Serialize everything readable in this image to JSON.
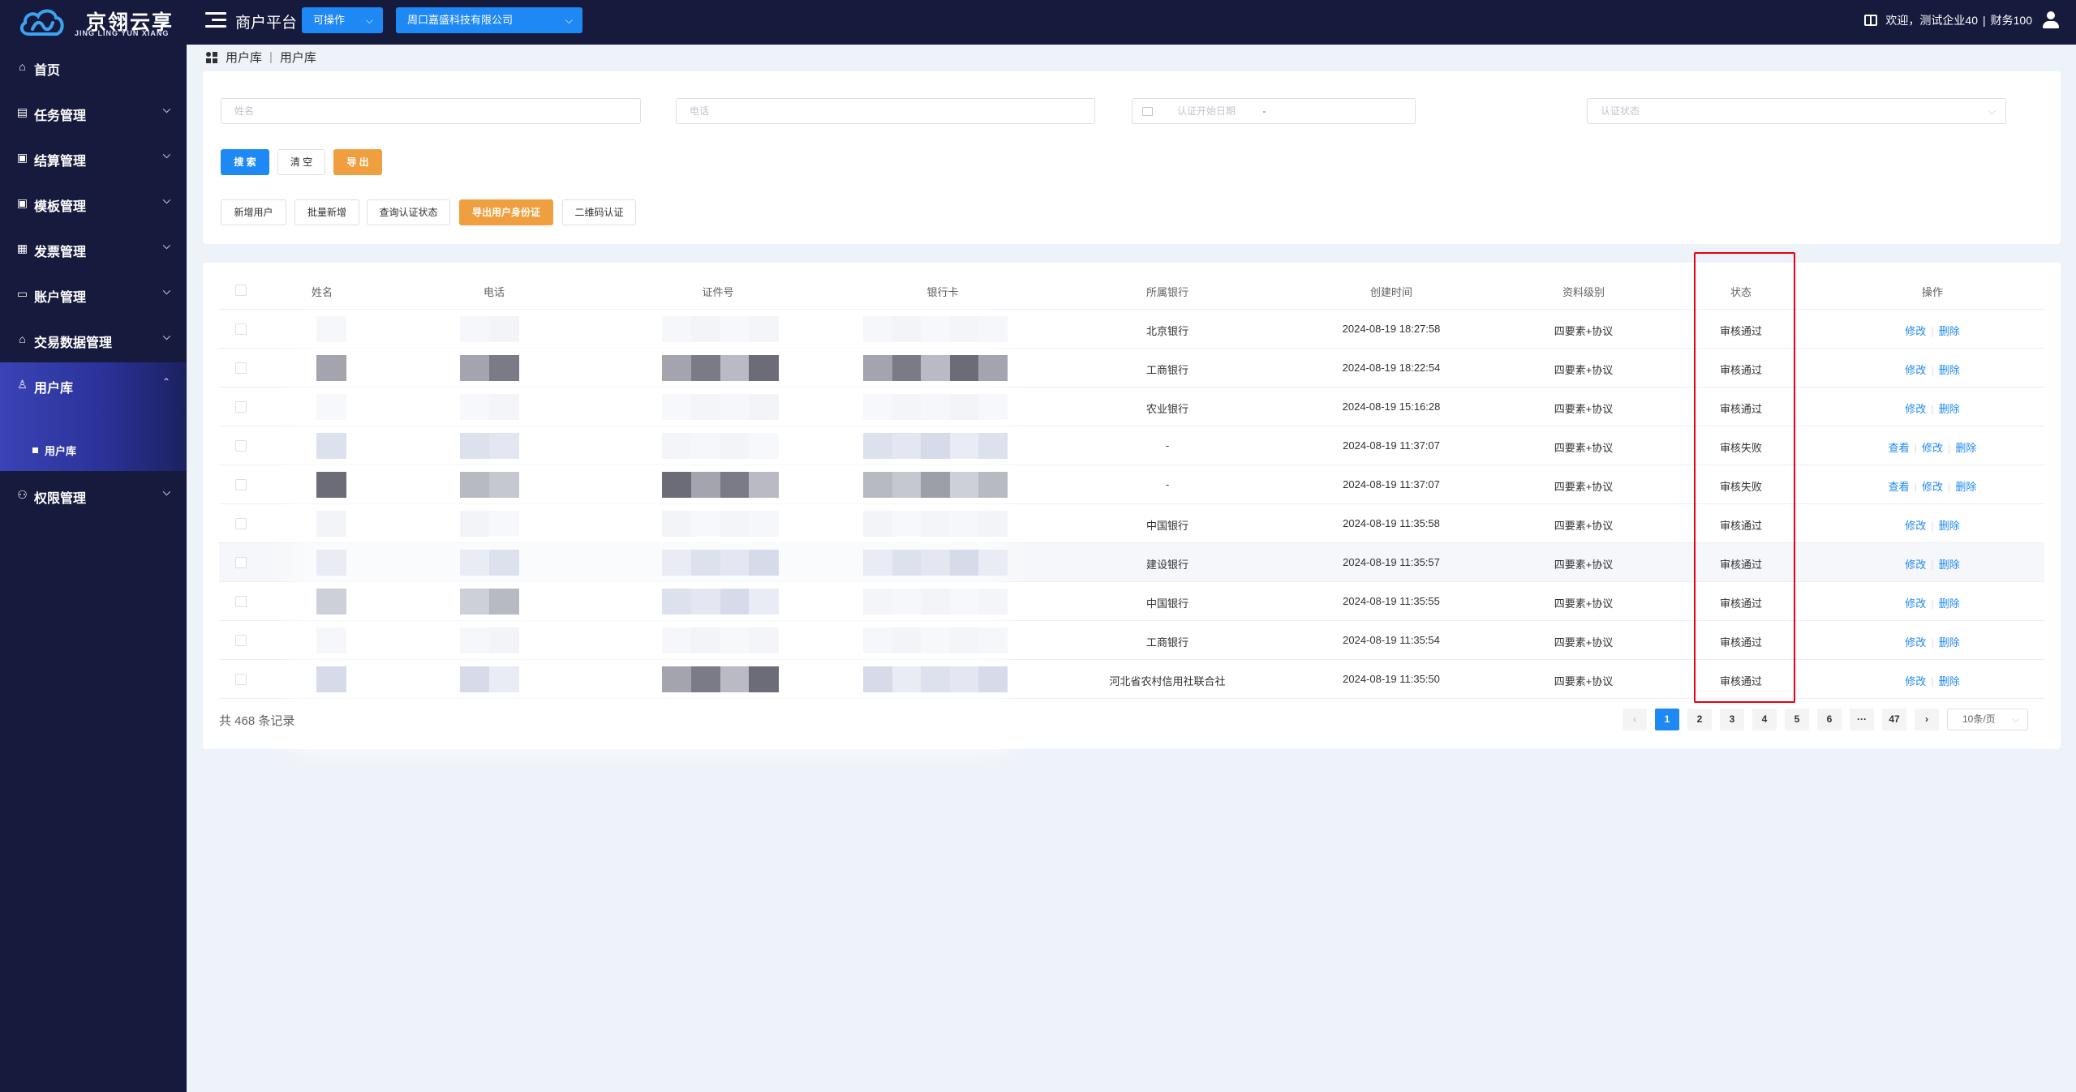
{
  "brand": {
    "title": "京翎云享",
    "subtitle": "JING LING YUN XIANG"
  },
  "header": {
    "platform": "商户平台",
    "mode_select": "可操作",
    "company_select": "周口嘉盛科技有限公司",
    "welcome": "欢迎，测试企业40",
    "user": "财务100"
  },
  "sidebar": {
    "items": [
      {
        "label": "首页",
        "icon": "home-icon"
      },
      {
        "label": "任务管理",
        "icon": "task-icon"
      },
      {
        "label": "结算管理",
        "icon": "settlement-icon"
      },
      {
        "label": "模板管理",
        "icon": "template-icon"
      },
      {
        "label": "发票管理",
        "icon": "invoice-icon"
      },
      {
        "label": "账户管理",
        "icon": "account-icon"
      },
      {
        "label": "交易数据管理",
        "icon": "transaction-icon"
      },
      {
        "label": "用户库",
        "icon": "user-icon"
      },
      {
        "label": "权限管理",
        "icon": "permission-icon"
      }
    ],
    "submenu": "用户库"
  },
  "breadcrumb": {
    "parent": "用户库",
    "current": "用户库"
  },
  "search": {
    "name_placeholder": "姓名",
    "phone_placeholder": "电话",
    "date_start_placeholder": "认证开始日期",
    "date_sep": "-",
    "status_placeholder": "认证状态"
  },
  "buttons": {
    "search": "搜 索",
    "clear": "清 空",
    "export": "导 出",
    "add_user": "新增用户",
    "batch_add": "批量新增",
    "query_status": "查询认证状态",
    "export_id": "导出用户身份证",
    "qr_auth": "二维码认证"
  },
  "table": {
    "headers": [
      "姓名",
      "电话",
      "证件号",
      "银行卡",
      "所属银行",
      "创建时间",
      "资料级别",
      "状态",
      "操作"
    ],
    "rows": [
      {
        "bank": "北京银行",
        "created": "2024-08-19 18:27:58",
        "level": "四要素+协议",
        "status": "审核通过",
        "ops": [
          "修改",
          "删除"
        ]
      },
      {
        "bank": "工商银行",
        "created": "2024-08-19 18:22:54",
        "level": "四要素+协议",
        "status": "审核通过",
        "ops": [
          "修改",
          "删除"
        ]
      },
      {
        "bank": "农业银行",
        "created": "2024-08-19 15:16:28",
        "level": "四要素+协议",
        "status": "审核通过",
        "ops": [
          "修改",
          "删除"
        ]
      },
      {
        "bank": "-",
        "created": "2024-08-19 11:37:07",
        "level": "四要素+协议",
        "status": "审核失败",
        "ops": [
          "查看",
          "修改",
          "删除"
        ]
      },
      {
        "bank": "-",
        "created": "2024-08-19 11:37:07",
        "level": "四要素+协议",
        "status": "审核失败",
        "ops": [
          "查看",
          "修改",
          "删除"
        ]
      },
      {
        "bank": "中国银行",
        "created": "2024-08-19 11:35:58",
        "level": "四要素+协议",
        "status": "审核通过",
        "ops": [
          "修改",
          "删除"
        ]
      },
      {
        "bank": "建设银行",
        "created": "2024-08-19 11:35:57",
        "level": "四要素+协议",
        "status": "审核通过",
        "ops": [
          "修改",
          "删除"
        ]
      },
      {
        "bank": "中国银行",
        "created": "2024-08-19 11:35:55",
        "level": "四要素+协议",
        "status": "审核通过",
        "ops": [
          "修改",
          "删除"
        ]
      },
      {
        "bank": "工商银行",
        "created": "2024-08-19 11:35:54",
        "level": "四要素+协议",
        "status": "审核通过",
        "ops": [
          "修改",
          "删除"
        ]
      },
      {
        "bank": "河北省农村信用社联合社",
        "created": "2024-08-19 11:35:50",
        "level": "四要素+协议",
        "status": "审核通过",
        "ops": [
          "修改",
          "删除"
        ]
      }
    ]
  },
  "pagination": {
    "total": "共 468 条记录",
    "pages": [
      "1",
      "2",
      "3",
      "4",
      "5",
      "6",
      "···",
      "47"
    ],
    "page_size": "10条/页"
  },
  "colors": {
    "primary": "#1e88f5",
    "sidebar": "#161a3d",
    "orange": "#ef9f3f",
    "highlight": "#e60012"
  }
}
